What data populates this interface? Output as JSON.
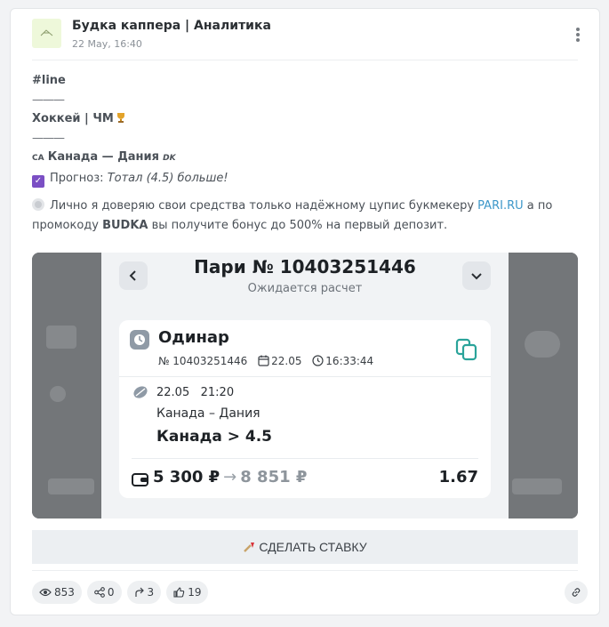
{
  "channel": {
    "name": "Будка каппера | Аналитика",
    "date": "22 May, 16:40"
  },
  "post": {
    "tag": "#line",
    "separator": "———",
    "league": "Хоккей | ЧМ",
    "team_home_code": "CA",
    "match": "Канада — Дания",
    "team_away_code": "DK",
    "forecast_label": "Прогноз:",
    "forecast_value": "Тотал (4.5) больше!",
    "promo_pre": "Лично я доверяю свои средства только надёжному цупис букмекеру",
    "promo_link": "PARI.RU",
    "promo_mid": "а по промокоду",
    "promo_code": "BUDKA",
    "promo_post": "вы получите бонус до 500% на первый депозит."
  },
  "bet_screenshot": {
    "title": "Пари № 10403251446",
    "status": "Ожидается расчет",
    "bet_type": "Одинар",
    "bet_number": "№ 10403251446",
    "bet_date": "22.05",
    "bet_time": "16:33:44",
    "event_date": "22.05",
    "event_time": "21:20",
    "teams": "Канада – Дания",
    "pick": "Канада > 4.5",
    "stake": "5 300 ₽",
    "arrow": "→",
    "payout": "8 851 ₽",
    "coefficient": "1.67"
  },
  "cta": {
    "label": "СДЕЛАТЬ СТАВКУ"
  },
  "stats": {
    "views": "853",
    "shares": "0",
    "forwards": "3",
    "likes": "19"
  },
  "icons": [
    "more-vert-icon",
    "trophy-icon",
    "checkbox-icon",
    "disc-icon",
    "chevron-left-icon",
    "chevron-down-icon",
    "clock-icon",
    "copy-icon",
    "calendar-icon",
    "hockey-puck-icon",
    "wallet-icon",
    "pin-icon",
    "eye-icon",
    "share-icon",
    "forward-icon",
    "thumbs-up-icon",
    "link-icon"
  ],
  "colors": {
    "link": "#3d97c9",
    "check": "#7b4fc4",
    "copy": "#2aa39a"
  }
}
